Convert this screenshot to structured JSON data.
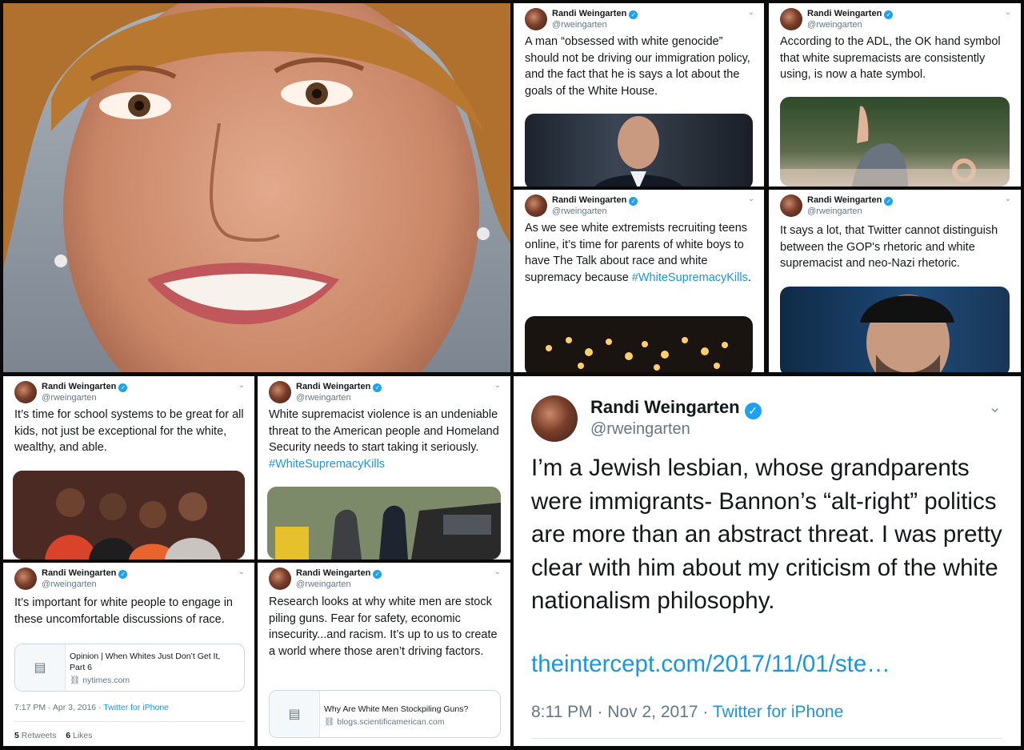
{
  "author": {
    "name": "Randi Weingarten",
    "handle": "@rweingarten",
    "verified_icon": "verified-badge-icon",
    "accent": "#1da1f2"
  },
  "tweets": [
    {
      "text": "A man “obsessed with white genocide” should not be driving our immigration policy, and the fact that he is says a lot about the goals of the White House."
    },
    {
      "text": "According to the ADL, the OK hand symbol that white supremacists are consistently using, is now a hate symbol."
    },
    {
      "text": "As we see white extremists recruiting teens online, it’s time for parents of white boys to have The Talk about race and white supremacy because ",
      "hashtag": "#WhiteSupremacyKills",
      "tail": "."
    },
    {
      "text": "It says a lot, that Twitter cannot distinguish between the GOP's rhetoric and white supremacist and neo-Nazi rhetoric."
    },
    {
      "text": "It’s time for school systems to be great for all kids, not just be exceptional for the white, wealthy, and able."
    },
    {
      "text": "White supremacist violence is an undeniable threat to the American people and Homeland Security needs to start taking it seriously. ",
      "hashtag": "#WhiteSupremacyKills"
    },
    {
      "text": "It’s important for white people to engage in these uncomfortable discussions of race.",
      "card_title": "Opinion | When Whites Just Don’t Get It, Part 6",
      "card_domain": "nytimes.com",
      "time": "7:17 PM · Apr 3, 2016 ·",
      "source": "Twitter for iPhone",
      "retweets": "5",
      "retweets_label": "Retweets",
      "likes": "6",
      "likes_label": "Likes"
    },
    {
      "text": "Research looks at why white men are stock piling guns. Fear for safety, economic insecurity...and racism. It’s up to us to create a world where those aren’t driving factors.",
      "card_title": "Why Are White Men Stockpiling Guns?",
      "card_domain": "blogs.scientificamerican.com"
    },
    {
      "text": "I’m a Jewish lesbian, whose grandparents were immigrants- Bannon’s “alt-right” politics are more than an abstract threat. I was pretty clear with him about my criticism of the white nationalism philosophy.",
      "link": "theintercept.com/2017/11/01/ste…",
      "time": "8:11 PM · Nov 2, 2017 ·",
      "source": "Twitter for iPhone"
    }
  ],
  "icons": {
    "chevron": "chevron-down-icon",
    "link": "link-icon",
    "card": "article-card-icon"
  }
}
